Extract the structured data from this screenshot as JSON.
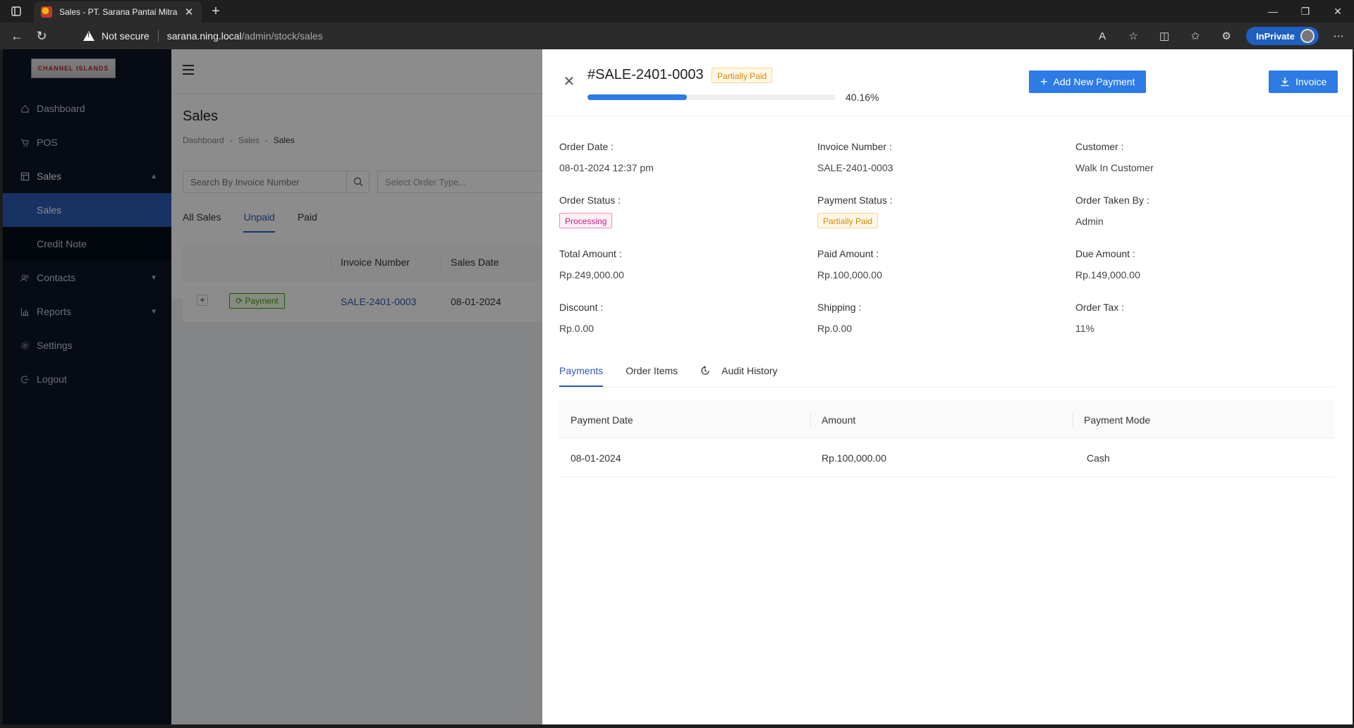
{
  "browser": {
    "tab_title": "Sales - PT. Sarana Pantai Mitra Se",
    "not_secure": "Not secure",
    "url_host": "sarana.ning.local",
    "url_path": "/admin/stock/sales",
    "inprivate": "InPrivate"
  },
  "logo": {
    "text": "CHANNEL ISLANDS"
  },
  "sidebar": {
    "items": [
      {
        "label": "Dashboard"
      },
      {
        "label": "POS"
      },
      {
        "label": "Sales"
      },
      {
        "label": "Contacts"
      },
      {
        "label": "Reports"
      },
      {
        "label": "Settings"
      },
      {
        "label": "Logout"
      }
    ],
    "sales_sub": [
      {
        "label": "Sales"
      },
      {
        "label": "Credit Note"
      }
    ]
  },
  "page": {
    "title": "Sales",
    "breadcrumb": [
      "Dashboard",
      "Sales",
      "Sales"
    ],
    "search_placeholder": "Search By Invoice Number",
    "select_placeholder": "Select Order Type...",
    "tabs": [
      "All Sales",
      "Unpaid",
      "Paid"
    ],
    "table_headers": [
      "Invoice Number",
      "Sales Date"
    ],
    "row": {
      "expand": "+",
      "payment_tag": "Payment",
      "invoice": "SALE-2401-0003",
      "date": "08-01-2024"
    }
  },
  "drawer": {
    "title": "#SALE-2401-0003",
    "status_tag": "Partially Paid",
    "progress_percent": 40.16,
    "progress_label": "40.16%",
    "add_payment": "Add New Payment",
    "invoice_btn": "Invoice",
    "fields": {
      "order_date_label": "Order Date :",
      "order_date": "08-01-2024 12:37 pm",
      "invoice_number_label": "Invoice Number :",
      "invoice_number": "SALE-2401-0003",
      "customer_label": "Customer :",
      "customer": "Walk In Customer",
      "order_status_label": "Order Status :",
      "order_status": "Processing",
      "payment_status_label": "Payment Status :",
      "payment_status": "Partially Paid",
      "order_taken_by_label": "Order Taken By :",
      "order_taken_by": "Admin",
      "total_amount_label": "Total Amount :",
      "total_amount": "Rp.249,000.00",
      "paid_amount_label": "Paid Amount :",
      "paid_amount": "Rp.100,000.00",
      "due_amount_label": "Due Amount :",
      "due_amount": "Rp.149,000.00",
      "discount_label": "Discount :",
      "discount": "Rp.0.00",
      "shipping_label": "Shipping :",
      "shipping": "Rp.0.00",
      "order_tax_label": "Order Tax :",
      "order_tax": "11%"
    },
    "tabs": [
      "Payments",
      "Order Items",
      "Audit History"
    ],
    "payments_table": {
      "headers": [
        "Payment Date",
        "Amount",
        "Payment Mode"
      ],
      "rows": [
        {
          "date": "08-01-2024",
          "amount": "Rp.100,000.00",
          "mode": "Cash"
        }
      ]
    }
  },
  "colors": {
    "sidebar_bg": "#0b1426",
    "active_menu": "#2c5bb5",
    "primary": "#2d7be5"
  }
}
